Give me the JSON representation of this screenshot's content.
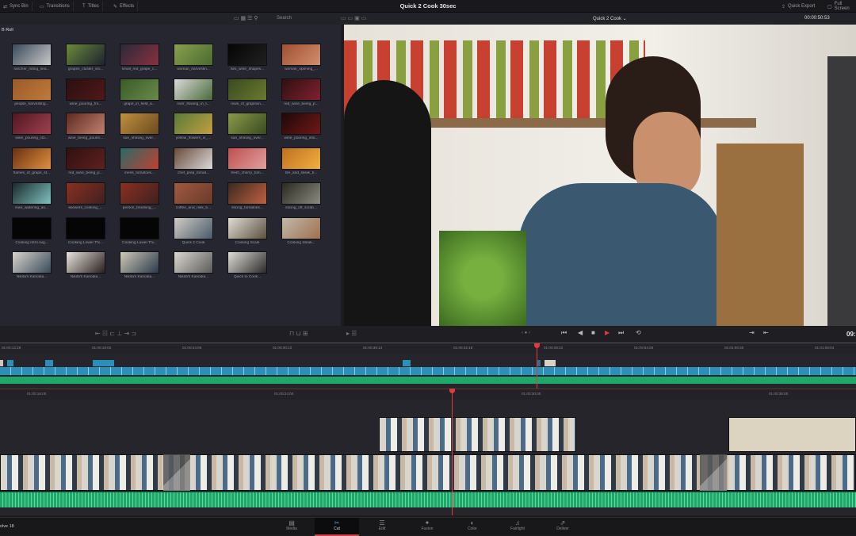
{
  "topbar": {
    "title": "Quick 2 Cook 30sec",
    "left": [
      {
        "icon": "sync-bin-icon",
        "label": "Sync Bin"
      },
      {
        "icon": "transitions-icon",
        "label": "Transitions"
      },
      {
        "icon": "titles-icon",
        "label": "Titles"
      },
      {
        "icon": "effects-icon",
        "label": "Effects"
      }
    ],
    "quick_export": "Quick Export",
    "full_screen": "Full Screen"
  },
  "pool_toolbar": {
    "search_placeholder": "Search"
  },
  "viewer": {
    "timeline_name": "Quick 2 Cook",
    "timecode": "00:00:50:53",
    "right_tc": "09:"
  },
  "bin": {
    "name": "B Roll",
    "clips": [
      {
        "label": "rancher_riding_sea...",
        "c1": "#3a4a5a",
        "c2": "#c8c8c8"
      },
      {
        "label": "grapes_cluster_vin...",
        "c1": "#6a8a3a",
        "c2": "#1e2230"
      },
      {
        "label": "small_red_grape_c...",
        "c1": "#2a2a3a",
        "c2": "#8a3040"
      },
      {
        "label": "woman_harvestin...",
        "c1": "#8aa050",
        "c2": "#4a6a30"
      },
      {
        "label": "two_wine_shapes...",
        "c1": "#050505",
        "c2": "#202020"
      },
      {
        "label": "woman_opening_...",
        "c1": "#a05030",
        "c2": "#d09070"
      },
      {
        "label": "people_harvesting...",
        "c1": "#9a5a2a",
        "c2": "#c07a3a"
      },
      {
        "label": "wine_pouring_fro...",
        "c1": "#2a1010",
        "c2": "#501818"
      },
      {
        "label": "grape_in_field_a...",
        "c1": "#3a5a2a",
        "c2": "#6a8a4a"
      },
      {
        "label": "river_flowing_in_t...",
        "c1": "#dadada",
        "c2": "#4a6a3a"
      },
      {
        "label": "rows_of_grapevin...",
        "c1": "#3a4a20",
        "c2": "#6a7a30"
      },
      {
        "label": "red_wine_being_p...",
        "c1": "#301010",
        "c2": "#802030"
      },
      {
        "label": "wine_pouring_clo...",
        "c1": "#501820",
        "c2": "#a04050"
      },
      {
        "label": "wine_being_pourin...",
        "c1": "#602a20",
        "c2": "#c08070"
      },
      {
        "label": "sun_shining_over...",
        "c1": "#c09040",
        "c2": "#6a4a20"
      },
      {
        "label": "yellow_flowers_in_...",
        "c1": "#5a7a3a",
        "c2": "#c0a040"
      },
      {
        "label": "sun_shining_over...",
        "c1": "#8a9a4a",
        "c2": "#3a4a20"
      },
      {
        "label": "wine_pouring_into...",
        "c1": "#200808",
        "c2": "#701818"
      },
      {
        "label": "flames_of_grape_st...",
        "c1": "#6a3010",
        "c2": "#e09040"
      },
      {
        "label": "red_wine_being_p...",
        "c1": "#301010",
        "c2": "#602020"
      },
      {
        "label": "mens_tomatoes...",
        "c1": "#2a6a6a",
        "c2": "#c04030"
      },
      {
        "label": "chef_prep_tomat...",
        "c1": "#6a4a3a",
        "c2": "#dadada"
      },
      {
        "label": "fresh_cherry_tom...",
        "c1": "#c05050",
        "c2": "#e0a0a0"
      },
      {
        "label": "fire_and_steak_b...",
        "c1": "#c07020",
        "c2": "#f0b040"
      },
      {
        "label": "man_watering_an...",
        "c1": "#1a2a2a",
        "c2": "#80c0c0"
      },
      {
        "label": "skewers_cooking_...",
        "c1": "#8a3020",
        "c2": "#402020"
      },
      {
        "label": "person_brushing_...",
        "c1": "#8a3020",
        "c2": "#402020"
      },
      {
        "label": "coffee_and_milk_b...",
        "c1": "#a05a40",
        "c2": "#6a3a2a"
      },
      {
        "label": "slicing_tomatoes...",
        "c1": "#3a2a20",
        "c2": "#c06040"
      },
      {
        "label": "slicing_off_scrab...",
        "c1": "#2a2a20",
        "c2": "#8a8a80"
      },
      {
        "label": "Cooking Intro.svg...",
        "c1": "#050505",
        "c2": "#050505"
      },
      {
        "label": "Cooking Lower Thi...",
        "c1": "#050505",
        "c2": "#050505"
      },
      {
        "label": "Cooking Lower Thi...",
        "c1": "#050505",
        "c2": "#050505"
      },
      {
        "label": "Quick 2 Cook",
        "c1": "#d0ccc4",
        "c2": "#4a5a6a"
      },
      {
        "label": "Cooking Scale",
        "c1": "#e0dcd4",
        "c2": "#5a5040"
      },
      {
        "label": "Cooking Steak...",
        "c1": "#c0b8a8",
        "c2": "#a07050"
      },
      {
        "label": "Nikita's Kanodia...",
        "c1": "#d8d4cc",
        "c2": "#3a4a5a"
      },
      {
        "label": "Nikita's Kanodia...",
        "c1": "#e8e4dc",
        "c2": "#2a2020"
      },
      {
        "label": "Nikita's Kanodia...",
        "c1": "#d0c8b8",
        "c2": "#2a3a4a"
      },
      {
        "label": "Nikita's Kanodia...",
        "c1": "#dcd8d0",
        "c2": "#5a5a5a"
      },
      {
        "label": "Quick to Cook...",
        "c1": "#e0ddd6",
        "c2": "#2a2a2a"
      }
    ]
  },
  "ruler1": [
    "01:00:12:28",
    "01:00:18:02",
    "01:00:24:06",
    "01:00:30:10",
    "01:00:36:14",
    "01:00:42:18",
    "01:00:48:22",
    "01:00:54:26",
    "01:01:00:30",
    "01:01:06:04"
  ],
  "ruler2": [
    "01:00:18:00",
    "01:00:24:00",
    "01:00:30:00",
    "01:00:36:00"
  ],
  "nav": [
    {
      "label": "Media",
      "icon": "media-icon",
      "g": "▤"
    },
    {
      "label": "Cut",
      "icon": "cut-icon",
      "g": "✂",
      "active": true
    },
    {
      "label": "Edit",
      "icon": "edit-icon",
      "g": "☰"
    },
    {
      "label": "Fusion",
      "icon": "fusion-icon",
      "g": "✦"
    },
    {
      "label": "Color",
      "icon": "color-icon",
      "g": "◐"
    },
    {
      "label": "Fairlight",
      "icon": "fairlight-icon",
      "g": "♫"
    },
    {
      "label": "Deliver",
      "icon": "deliver-icon",
      "g": "⇗"
    }
  ],
  "app": "olve 18",
  "colors": {
    "accent": "#d23c3c",
    "video_track": "#2b8fb8",
    "audio_track": "#1fa86a"
  }
}
